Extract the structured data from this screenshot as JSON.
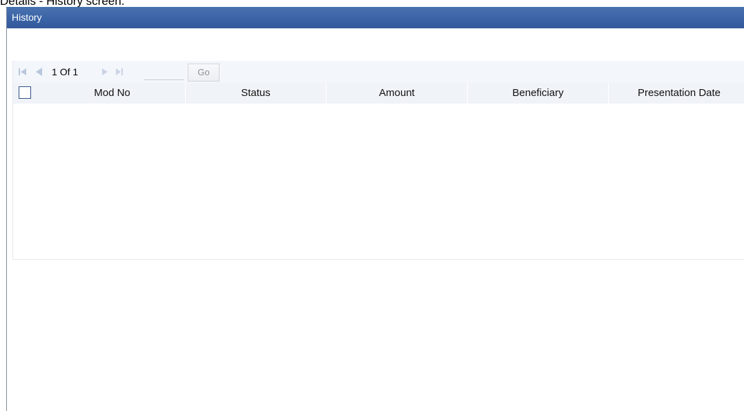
{
  "caption": "Details - History screen.",
  "window": {
    "title": "History"
  },
  "pagination": {
    "current": "1",
    "of_label": "Of",
    "total": "1",
    "page_input_value": "",
    "go_label": "Go"
  },
  "table": {
    "columns": [
      "Mod No",
      "Status",
      "Amount",
      "Beneficiary",
      "Presentation Date"
    ],
    "rows": []
  },
  "colors": {
    "title_bar": "#3a64a6",
    "toolbar_bg": "#f3f6fa",
    "header_bg": "#f0f3f8",
    "nav_icon": "#b8c7dd"
  },
  "icons": {
    "first": "first-page-icon",
    "prev": "previous-page-icon",
    "next": "next-page-icon",
    "last": "last-page-icon"
  }
}
